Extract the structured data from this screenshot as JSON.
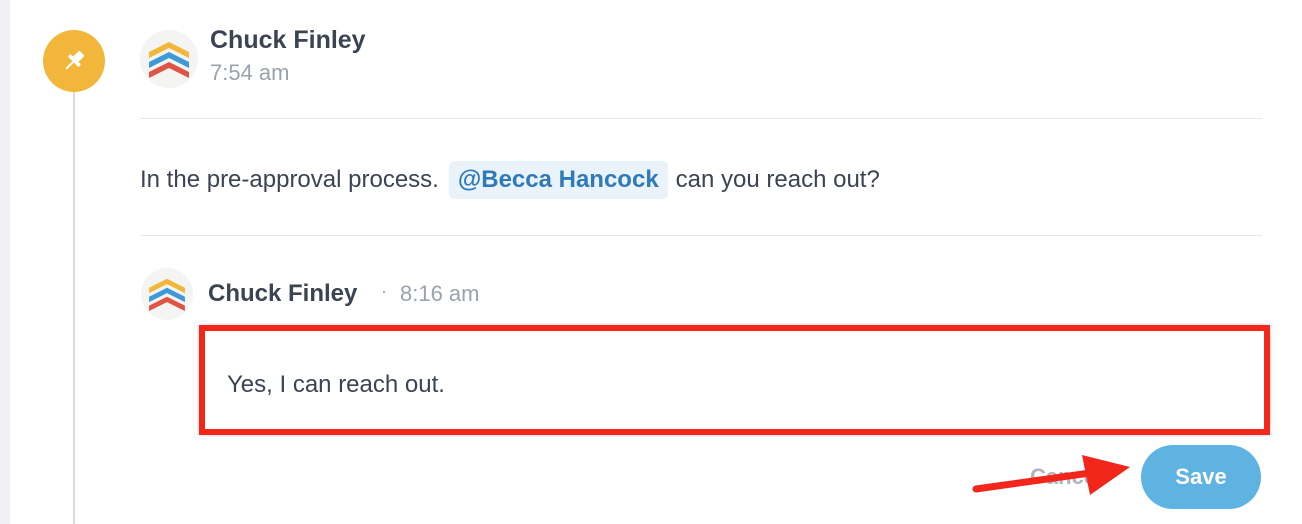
{
  "post": {
    "author": "Chuck Finley",
    "time": "7:54 am",
    "message_before": "In the pre-approval process.",
    "mention": "@Becca Hancock",
    "message_after": "can you reach out?"
  },
  "reply": {
    "author": "Chuck Finley",
    "separator": "·",
    "time": "8:16 am",
    "input_value": "Yes, I can reach out.",
    "cancel_label": "Cancel",
    "save_label": "Save"
  },
  "colors": {
    "pin_badge": "#f2b73a",
    "mention_text": "#2f7ab8",
    "save_button": "#5fb3e3",
    "highlight_annotation": "#f2261b"
  },
  "icons": {
    "pin": "pushpin-icon",
    "avatar": "chevron-stack-logo-avatar"
  }
}
